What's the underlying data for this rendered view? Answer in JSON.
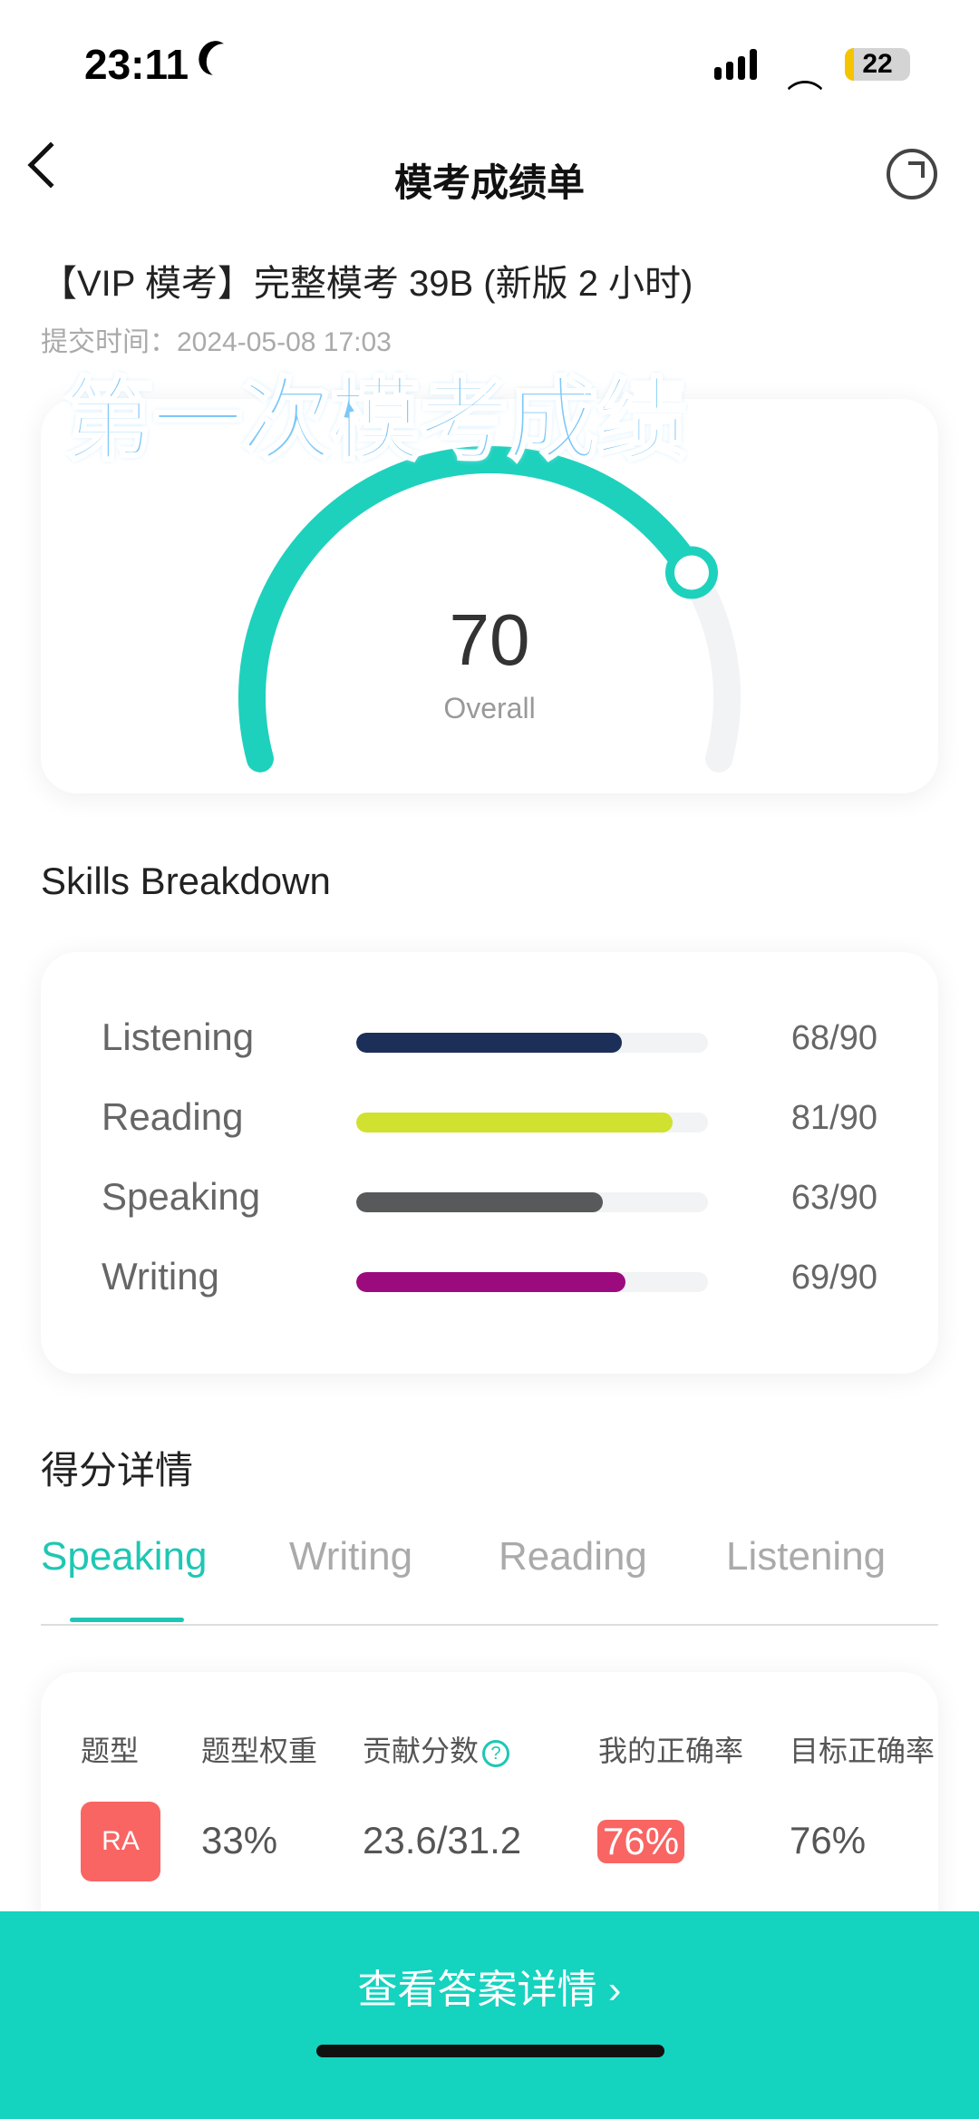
{
  "status": {
    "time": "23:11",
    "battery": "22"
  },
  "nav": {
    "title": "模考成绩单"
  },
  "exam": {
    "title": "【VIP 模考】完整模考 39B (新版 2 小时)",
    "submit_time": "提交时间：2024-05-08 17:03"
  },
  "overlay_caption": "第一次模考成绩",
  "overall": {
    "score": "70",
    "label": "Overall",
    "max": 90,
    "color": "#1ed1bd"
  },
  "skills": {
    "title": "Skills Breakdown",
    "items": [
      {
        "label": "Listening",
        "score": 68,
        "text": "68/90",
        "color": "#1c2f58"
      },
      {
        "label": "Reading",
        "score": 81,
        "text": "81/90",
        "color": "#d0e130"
      },
      {
        "label": "Speaking",
        "score": 63,
        "text": "63/90",
        "color": "#58595b"
      },
      {
        "label": "Writing",
        "score": 69,
        "text": "69/90",
        "color": "#9c0b7e"
      }
    ]
  },
  "details": {
    "title": "得分详情",
    "tabs": [
      "Speaking",
      "Writing",
      "Reading",
      "Listening"
    ],
    "headers": [
      "题型",
      "题型权重",
      "贡献分数",
      "我的正确率",
      "目标正确率"
    ],
    "help_icon": "?",
    "row": {
      "type": "RA",
      "weight": "33%",
      "contribution": "23.6/31.2",
      "my_accuracy": "76%",
      "target_accuracy": "76%"
    }
  },
  "bottom": {
    "button": "查看答案详情 ›"
  }
}
